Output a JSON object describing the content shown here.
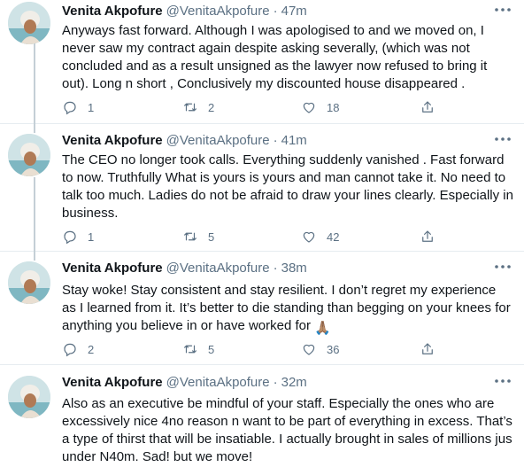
{
  "tweets": [
    {
      "display_name": "Venita Akpofure",
      "handle": "@VenitaAkpofure",
      "separator": "·",
      "time": "47m",
      "text": "Anyways fast forward. Although I was apologised to and we moved on, I never saw my contract again despite asking severally, (which was not concluded and as a result unsigned as the lawyer now refused to bring it out). Long n short , Conclusively my discounted house disappeared .",
      "replies": "1",
      "retweets": "2",
      "likes": "18"
    },
    {
      "display_name": "Venita Akpofure",
      "handle": "@VenitaAkpofure",
      "separator": "·",
      "time": "41m",
      "text": "The CEO no longer took calls. Everything suddenly vanished . Fast forward to now. Truthfully What is yours is yours and man cannot take it. No need to talk too much. Ladies do not be afraid to draw your lines clearly. Especially in business.",
      "replies": "1",
      "retweets": "5",
      "likes": "42"
    },
    {
      "display_name": "Venita Akpofure",
      "handle": "@VenitaAkpofure",
      "separator": "·",
      "time": "38m",
      "text": "Stay woke! Stay consistent and stay resilient. I don’t regret my experience as I learned from it. It’s better to die standing than begging on your knees for anything you believe in or have worked for",
      "emoji": "🙏🏽",
      "replies": "2",
      "retweets": "5",
      "likes": "36"
    },
    {
      "display_name": "Venita Akpofure",
      "handle": "@VenitaAkpofure",
      "separator": "·",
      "time": "32m",
      "text": "Also as an executive be mindful of your staff. Especially the ones who are excessively nice 4no reason n want to be part of everything in excess. That’s a type of thirst that will be insatiable. I actually brought in sales of millions jus under N40m. Sad! but we move!"
    }
  ],
  "icons": {
    "more": "more-horizontal-icon",
    "reply": "reply-icon",
    "retweet": "retweet-icon",
    "like": "heart-icon",
    "share": "share-icon"
  },
  "colors": {
    "text": "#0f1419",
    "secondary": "#5b7083",
    "divider": "#e6ecf0",
    "thread_line": "#c4cfd6"
  }
}
